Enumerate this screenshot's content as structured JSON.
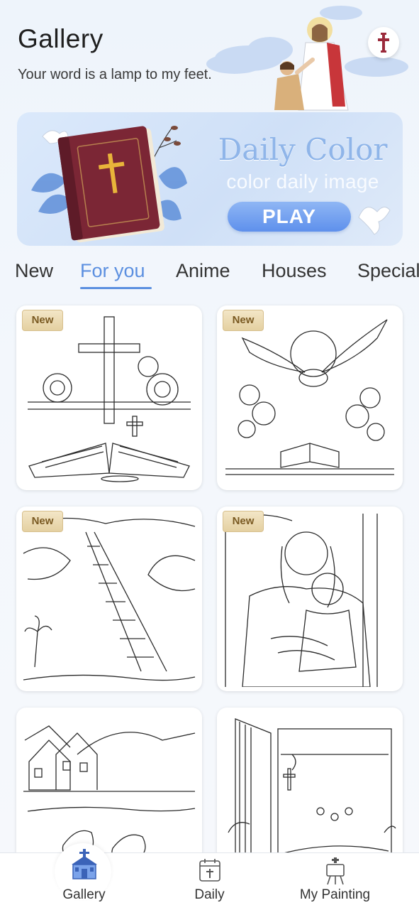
{
  "header": {
    "title": "Gallery",
    "subtitle": "Your word is a lamp to my feet."
  },
  "banner": {
    "title": "Daily Color",
    "subtitle": "color daily image",
    "play_label": "PLAY"
  },
  "tabs": [
    {
      "label": "New",
      "active": false
    },
    {
      "label": "For you",
      "active": true
    },
    {
      "label": "Anime",
      "active": false
    },
    {
      "label": "Houses",
      "active": false
    },
    {
      "label": "Special",
      "active": false
    }
  ],
  "cards": [
    {
      "badge": "New",
      "subject": "open bible with cross and roses"
    },
    {
      "badge": "New",
      "subject": "dove over bible with roses"
    },
    {
      "badge": "New",
      "subject": "ladder to the sky"
    },
    {
      "badge": "New",
      "subject": "jesus embracing a child"
    },
    {
      "badge": "",
      "subject": "house by a lake with ducks"
    },
    {
      "badge": "",
      "subject": "open book with scene"
    }
  ],
  "nav": [
    {
      "label": "Gallery",
      "icon": "church-icon",
      "active": true
    },
    {
      "label": "Daily",
      "icon": "calendar-icon",
      "active": false
    },
    {
      "label": "My Painting",
      "icon": "easel-icon",
      "active": false
    }
  ],
  "colors": {
    "accent": "#5b8fe0",
    "badge": "#e4d0a1",
    "banner_title": "#8fb5e9"
  }
}
